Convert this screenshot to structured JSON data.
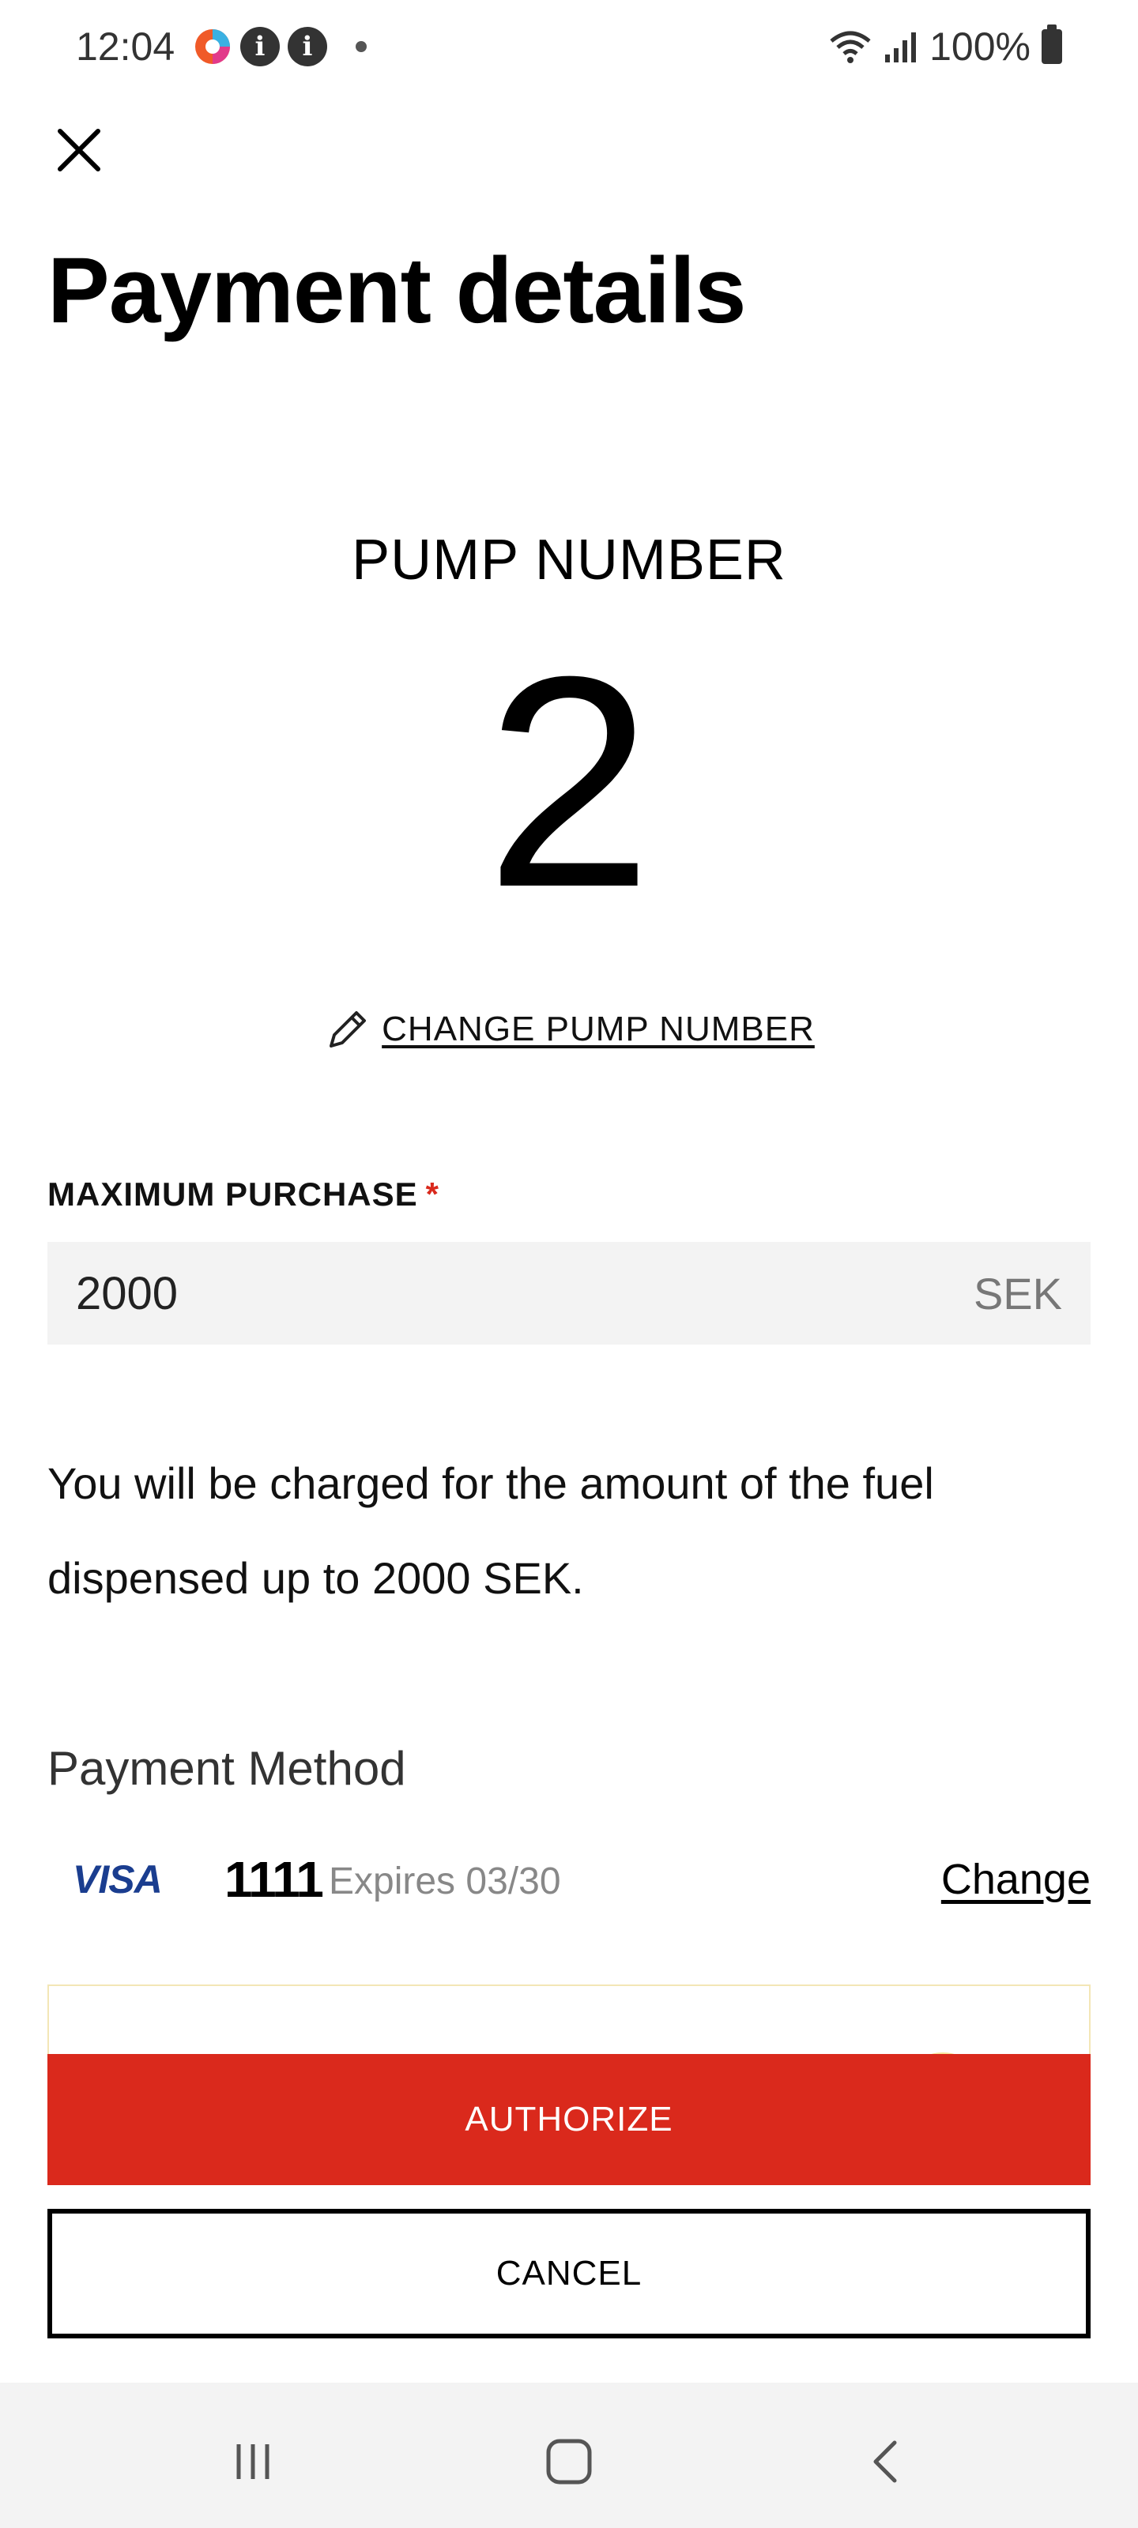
{
  "status_bar": {
    "time": "12:04",
    "battery": "100%",
    "icons": [
      "app-icon",
      "info-icon",
      "info-icon",
      "dot-icon",
      "wifi-icon",
      "signal-icon",
      "battery-icon"
    ]
  },
  "header": {
    "title": "Payment details",
    "close_icon": "close-icon"
  },
  "pump": {
    "label": "PUMP NUMBER",
    "number": "2",
    "change_label": "CHANGE PUMP NUMBER",
    "change_icon": "pencil-icon"
  },
  "max_purchase": {
    "label": "MAXIMUM PURCHASE",
    "required_mark": "*",
    "value": "2000",
    "currency": "SEK"
  },
  "charge_note": "You will be charged for the amount of the fuel dispensed up to 2000 SEK.",
  "payment_method": {
    "title": "Payment Method",
    "brand": "VISA",
    "last4": "1111",
    "expiry": "Expires 03/30",
    "change_label": "Change"
  },
  "actions": {
    "authorize": "AUTHORIZE",
    "cancel": "CANCEL"
  },
  "colors": {
    "accent_red": "#da291c",
    "visa_blue": "#1a3d8f",
    "field_bg": "#f3f3f3"
  },
  "nav": {
    "icons": [
      "recents-icon",
      "home-icon",
      "back-icon"
    ]
  }
}
